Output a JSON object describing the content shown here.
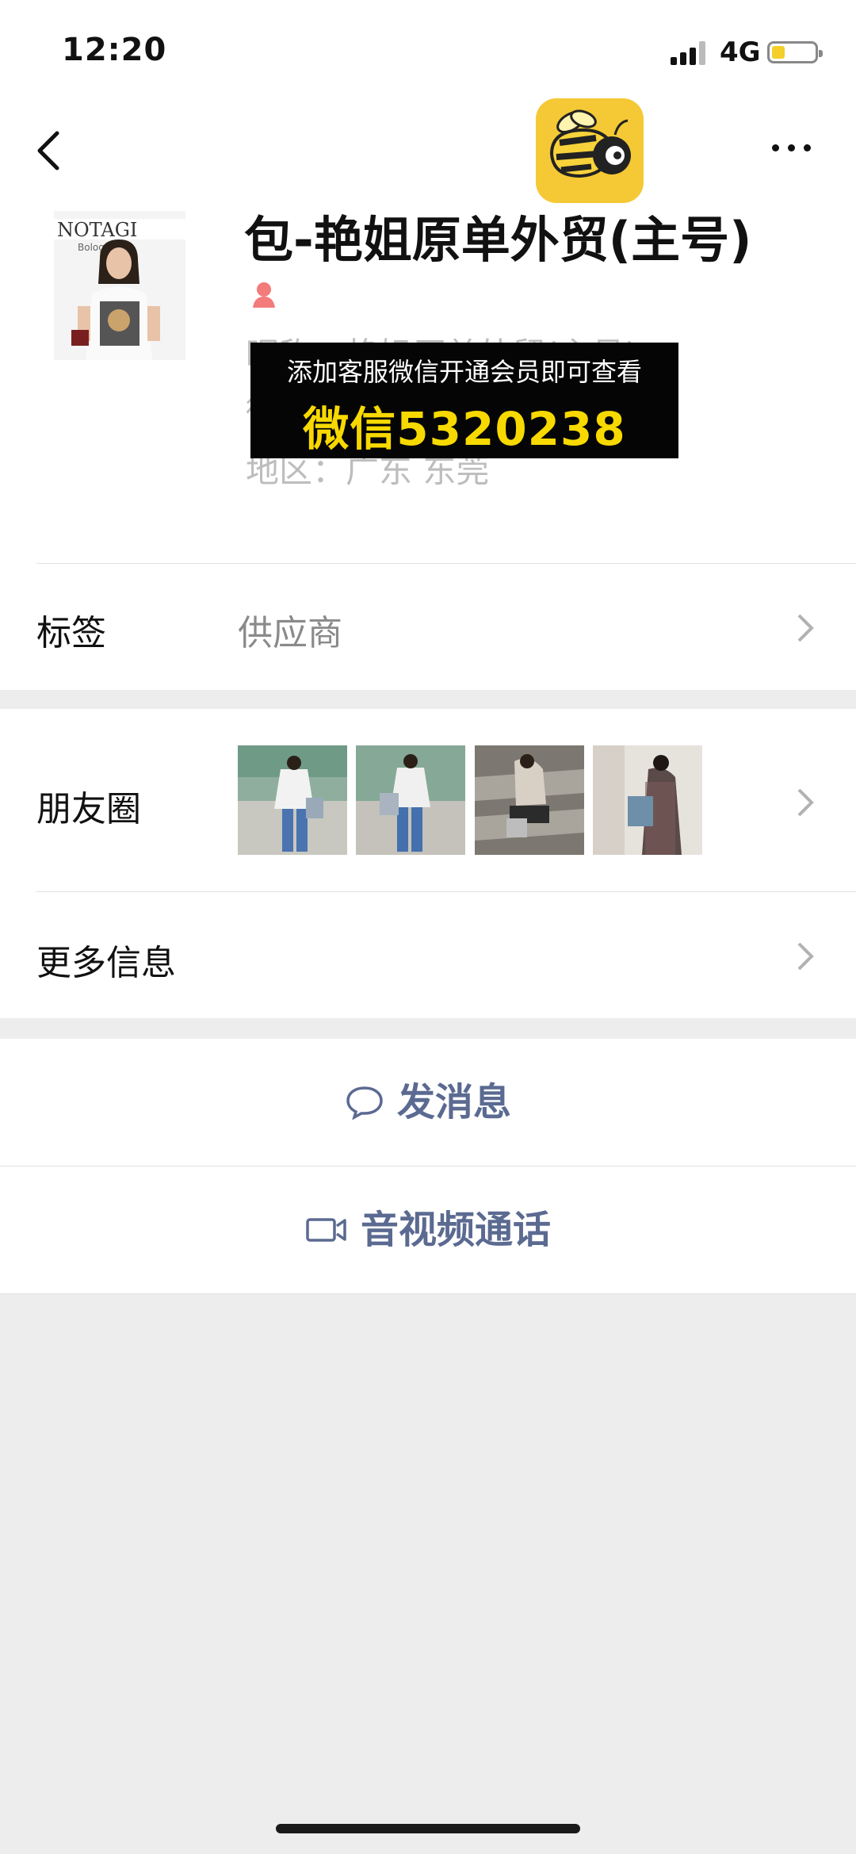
{
  "status_bar": {
    "time": "12:20",
    "network": "4G"
  },
  "profile": {
    "name": "包-艳姐原单外贸(主号)",
    "nickname_line": "昵称：艳姐原单外贸(主号)",
    "id_line": "微",
    "region_line": "地区：广东 东莞"
  },
  "overlay": {
    "line1": "添加客服微信开通会员即可查看",
    "line2": "微信5320238"
  },
  "rows": {
    "tags": {
      "label": "标签",
      "value": "供应商"
    },
    "moments": {
      "label": "朋友圈"
    },
    "more_info": {
      "label": "更多信息"
    }
  },
  "actions": {
    "message": "发消息",
    "call": "音视频通话"
  },
  "colors": {
    "accent_text": "#5b6a91",
    "overlay_text": "#f7d900",
    "app_icon": "#f5c935"
  }
}
